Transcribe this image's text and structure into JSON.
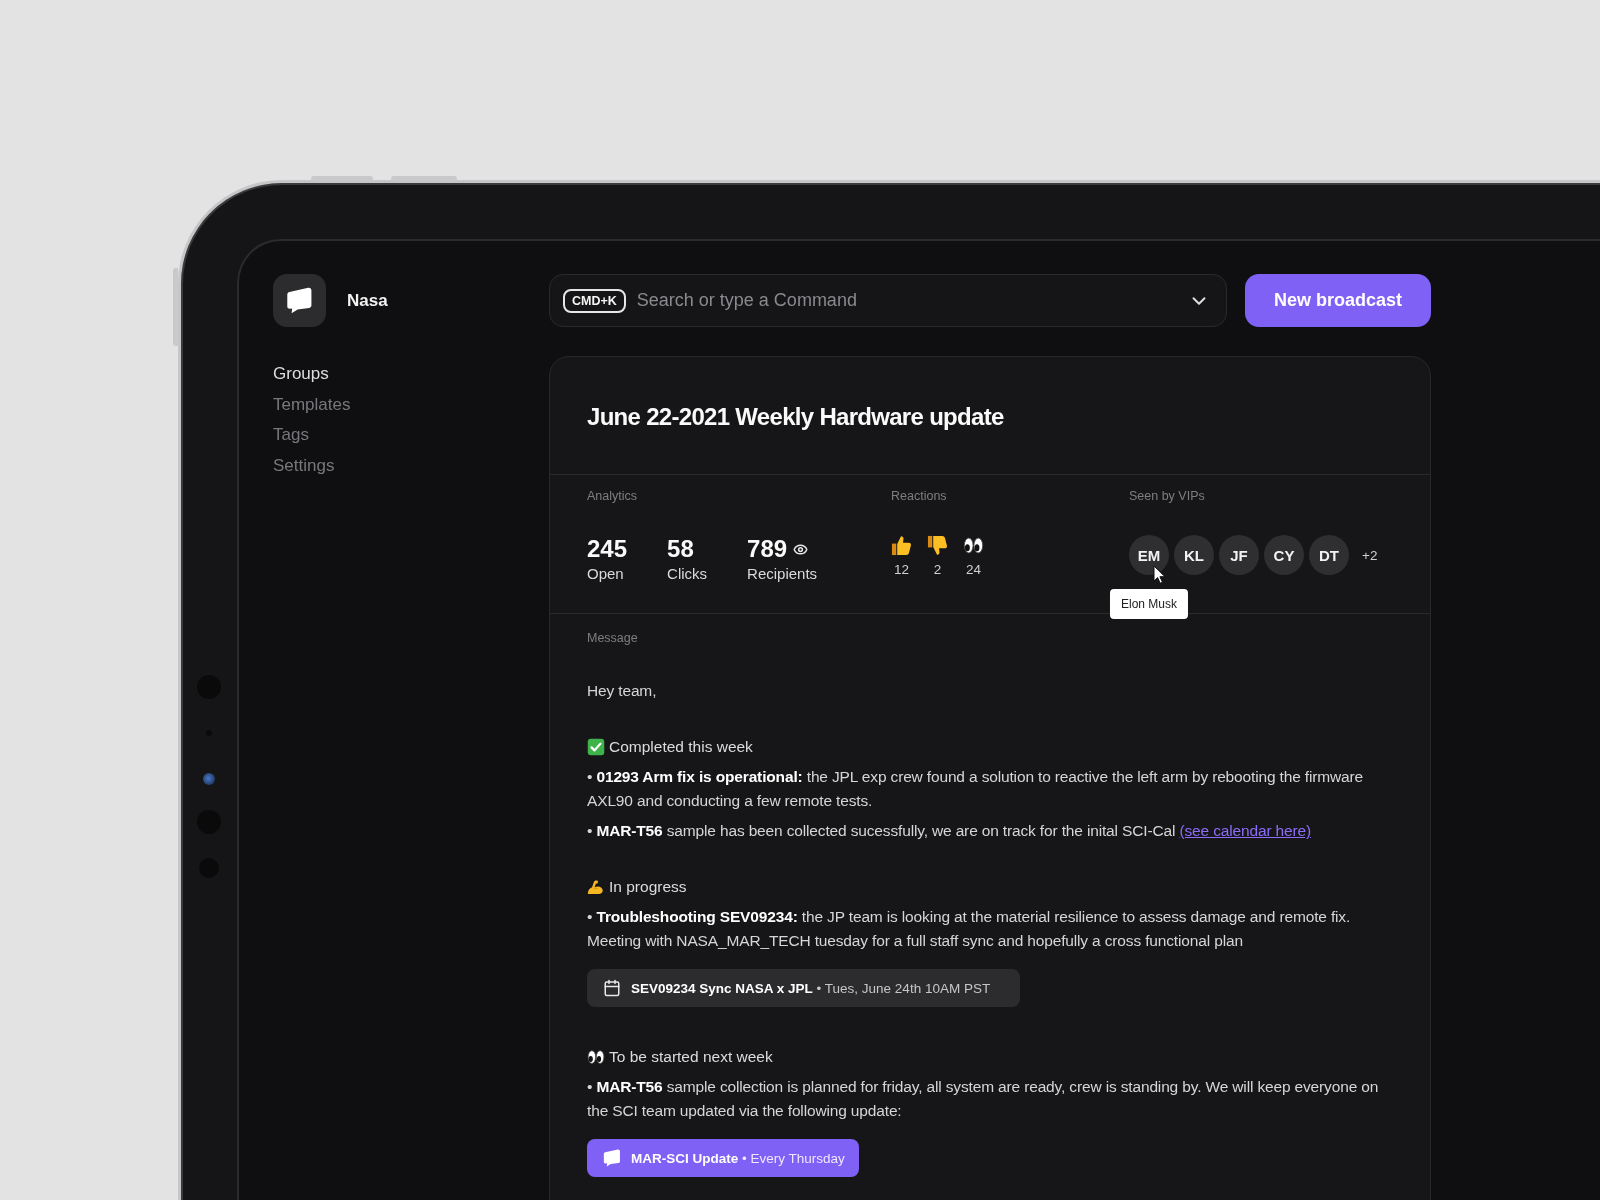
{
  "workspace": {
    "name": "Nasa"
  },
  "nav": [
    {
      "label": "Groups",
      "selected": true
    },
    {
      "label": "Templates",
      "selected": false
    },
    {
      "label": "Tags",
      "selected": false
    },
    {
      "label": "Settings",
      "selected": false
    }
  ],
  "search": {
    "shortcut": "CMD+K",
    "placeholder": "Search or type a Command"
  },
  "new_broadcast_button": {
    "label": "New broadcast"
  },
  "broadcast": {
    "title": "June 22-2021 Weekly Hardware update",
    "analytics": {
      "label": "Analytics",
      "stats": [
        {
          "kind": "count",
          "value": "245",
          "label": "Open"
        },
        {
          "kind": "count",
          "value": "58",
          "label": "Clicks"
        },
        {
          "kind": "views",
          "value": "789",
          "label": "Recipients"
        }
      ]
    },
    "reactions": {
      "label": "Reactions",
      "items": [
        {
          "kind": "thumbs_up",
          "count": "12"
        },
        {
          "kind": "thumbs_down",
          "count": "2"
        },
        {
          "kind": "eyes",
          "count": "24"
        }
      ]
    },
    "vips": {
      "label": "Seen by VIPs",
      "avatars": [
        {
          "initials": "EM",
          "tooltip": "Elon Musk"
        },
        {
          "initials": "KL"
        },
        {
          "initials": "JF"
        },
        {
          "initials": "CY"
        },
        {
          "initials": "DT"
        }
      ],
      "more": "+2"
    },
    "message": {
      "label": "Message",
      "blocks": [
        {
          "kind": "text",
          "text": "Hey team,"
        },
        {
          "kind": "heading",
          "text": "Completed this week"
        },
        {
          "kind": "bullet",
          "text": "• **01293 Arm fix is operational:** the JPL exp crew found a solution to reactive the left arm by rebooting the firmware AXL90 and conducting a few remote tests."
        },
        {
          "kind": "bullet",
          "text": "• **MAR-T56** sample has been collected sucessfully, we are on track for the inital SCI-Cal",
          "link": "(see calendar here)"
        },
        {
          "kind": "heading",
          "text": "In progress"
        },
        {
          "kind": "bullet",
          "text": "• **Troubleshooting SEV09234:** the JP team is looking at the material resilience to assess damage and remote fix. Meeting with NASA_MAR_TECH tuesday for a full staff sync and hopefully a cross functional plan"
        },
        {
          "kind": "event",
          "text": "**SEV09234 Sync NASA x JPL** • Tues, June 24th 10AM PST"
        },
        {
          "kind": "heading",
          "text": "To be started next week"
        },
        {
          "kind": "bullet",
          "text": "• **MAR-T56** sample collection is planned for friday, all system are ready, crew is standing by. We will keep everyone on the SCI team updated via the following update:"
        },
        {
          "kind": "broadcast",
          "text": "**MAR-SCI Update** • Every Thursday"
        }
      ]
    }
  }
}
